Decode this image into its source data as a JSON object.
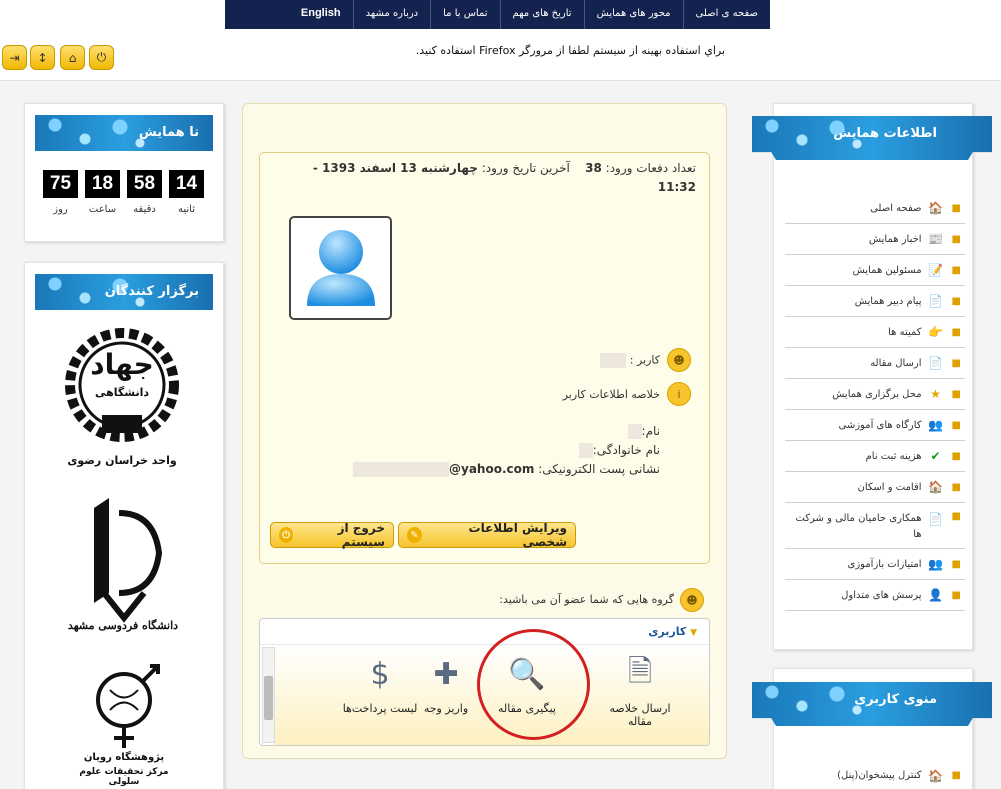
{
  "nav": {
    "items": [
      "صفحه ی اصلی",
      "محور های همایش",
      "تاریخ های مهم",
      "تماس با ما",
      "درباره مشهد",
      "English"
    ]
  },
  "toolbar": {
    "note": "براي استفاده بهينه از سيستم لطفا از مرورگر Firefox استفاده کنيد.",
    "buttons": [
      "power-icon",
      "home-icon",
      "up-down-icon",
      "exit-icon"
    ]
  },
  "countdown": {
    "title": "تا همایش",
    "values": {
      "seconds": "14",
      "minutes": "58",
      "hours": "18",
      "days": "75"
    },
    "labels": {
      "seconds": "ثانیه",
      "minutes": "دقیقه",
      "hours": "ساعت",
      "days": "روز"
    }
  },
  "organizers": {
    "title": "برگزار کنندگان",
    "logos": [
      {
        "main": "جهاد",
        "sub": "دانشگاهی",
        "caption": "واحد خراسان رضوی"
      },
      {
        "main": "دانشگاه فردوسی مشهد"
      },
      {
        "main": "پژوهشگاه رویان",
        "caption": "مرکز تحقیقات علوم سلولی"
      }
    ]
  },
  "info_menu": {
    "title": "اطلاعات همایش",
    "items": [
      {
        "label": "صفحه اصلی",
        "icon": "home-icon"
      },
      {
        "label": "اخبار همایش",
        "icon": "news-icon"
      },
      {
        "label": "مسئولین همایش",
        "icon": "edit-icon"
      },
      {
        "label": "پیام دبیر همایش",
        "icon": "message-icon"
      },
      {
        "label": "کمیته ها",
        "icon": "hand-icon"
      },
      {
        "label": "ارسال مقاله",
        "icon": "send-icon"
      },
      {
        "label": "محل برگزاری همایش",
        "icon": "star-icon"
      },
      {
        "label": "کارگاه های آموزشی",
        "icon": "group-icon"
      },
      {
        "label": "هزینه ثبت نام",
        "icon": "check-icon"
      },
      {
        "label": "اقامت و اسکان",
        "icon": "home-icon"
      },
      {
        "label": "همکاری حامیان مالی و شرکت ها",
        "icon": "document-icon"
      },
      {
        "label": "امتیازات بازآموزی",
        "icon": "group-icon"
      },
      {
        "label": "پرسش های متداول",
        "icon": "user-question-icon"
      }
    ]
  },
  "user_menu": {
    "title": "منوی کاربری",
    "items": [
      {
        "label": "کنترل پیشخوان(پنل)",
        "icon": "home-icon"
      }
    ]
  },
  "profile": {
    "login_count_label": "تعداد دفعات ورود:",
    "login_count": "38",
    "last_login_label": "آخرین تاریخ ورود:",
    "last_login": "چهارشنبه 13 اسفند 1393 - 11:32",
    "user_label": "کاربر :",
    "summary_label": "خلاصه اطلاعات کاربر",
    "first_name_label": "نام:",
    "last_name_label": "نام خانوادگی:",
    "email_label": "نشانی پست الکترونیکی:",
    "email_suffix": "@yahoo.com",
    "edit_button": "ویرایش اطلاعات شخصی",
    "logout_button": "خروج از سیستم"
  },
  "groups": {
    "label": "گروه هایی که شما عضو آن می باشید:",
    "tab": "کاربری",
    "items": [
      {
        "label": "ارسال خلاصه مقاله",
        "icon": "send-abstract-icon"
      },
      {
        "label": "پیگیری مقاله",
        "icon": "track-article-icon"
      },
      {
        "label": "واریز وجه",
        "icon": "deposit-icon"
      },
      {
        "label": "لیست پرداخت‌ها",
        "icon": "payment-list-icon"
      }
    ]
  },
  "colors": {
    "nav": "#14224f",
    "ribbon": "#1a78b8",
    "accent": "#f7c52b",
    "highlight": "#d22020"
  }
}
